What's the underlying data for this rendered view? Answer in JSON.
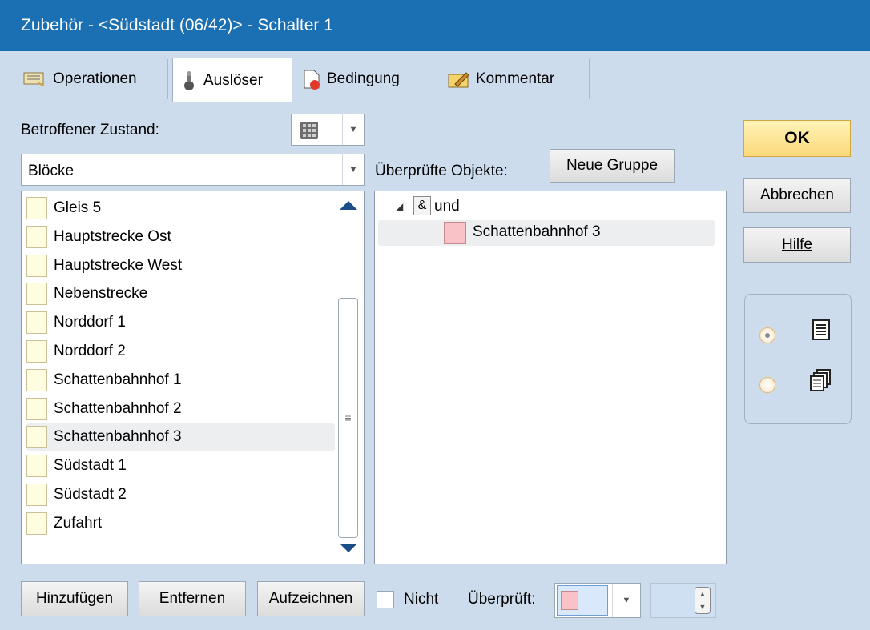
{
  "window": {
    "title": "Zubehör - <Südstadt (06/42)> - Schalter 1"
  },
  "tabs": [
    {
      "label": "Operationen",
      "icon": "operations-icon"
    },
    {
      "label": "Auslöser",
      "icon": "trigger-icon"
    },
    {
      "label": "Bedingung",
      "icon": "condition-icon"
    },
    {
      "label": "Kommentar",
      "icon": "comment-icon"
    }
  ],
  "left": {
    "state_label": "Betroffener Zustand:",
    "category_value": "Blöcke",
    "items": [
      "Gleis 5",
      "Hauptstrecke Ost",
      "Hauptstrecke West",
      "Nebenstrecke",
      "Norddorf 1",
      "Norddorf 2",
      "Schattenbahnhof 1",
      "Schattenbahnhof 2",
      "Schattenbahnhof 3",
      "Südstadt 1",
      "Südstadt 2",
      "Zufahrt"
    ],
    "selected_index": 8
  },
  "right": {
    "checked_objects_label": "Überprüfte Objekte:",
    "new_group_label": "Neue Gruppe",
    "tree_group_symbol": "&",
    "tree_group_label": "und",
    "tree_child_label": "Schattenbahnhof 3"
  },
  "buttons": {
    "ok": "OK",
    "cancel": "Abbrechen",
    "help": "Hilfe",
    "add": "Hinzufügen",
    "remove": "Entfernen",
    "record": "Aufzeichnen"
  },
  "bottom": {
    "not_label": "Nicht",
    "checked_label": "Überprüft:"
  },
  "colors": {
    "title_bar": "#1b6fb3",
    "background": "#cddcec",
    "block_swatch": "#fffde0",
    "checked_swatch": "#f8c2c6",
    "ok_button": "#fbd97a"
  }
}
